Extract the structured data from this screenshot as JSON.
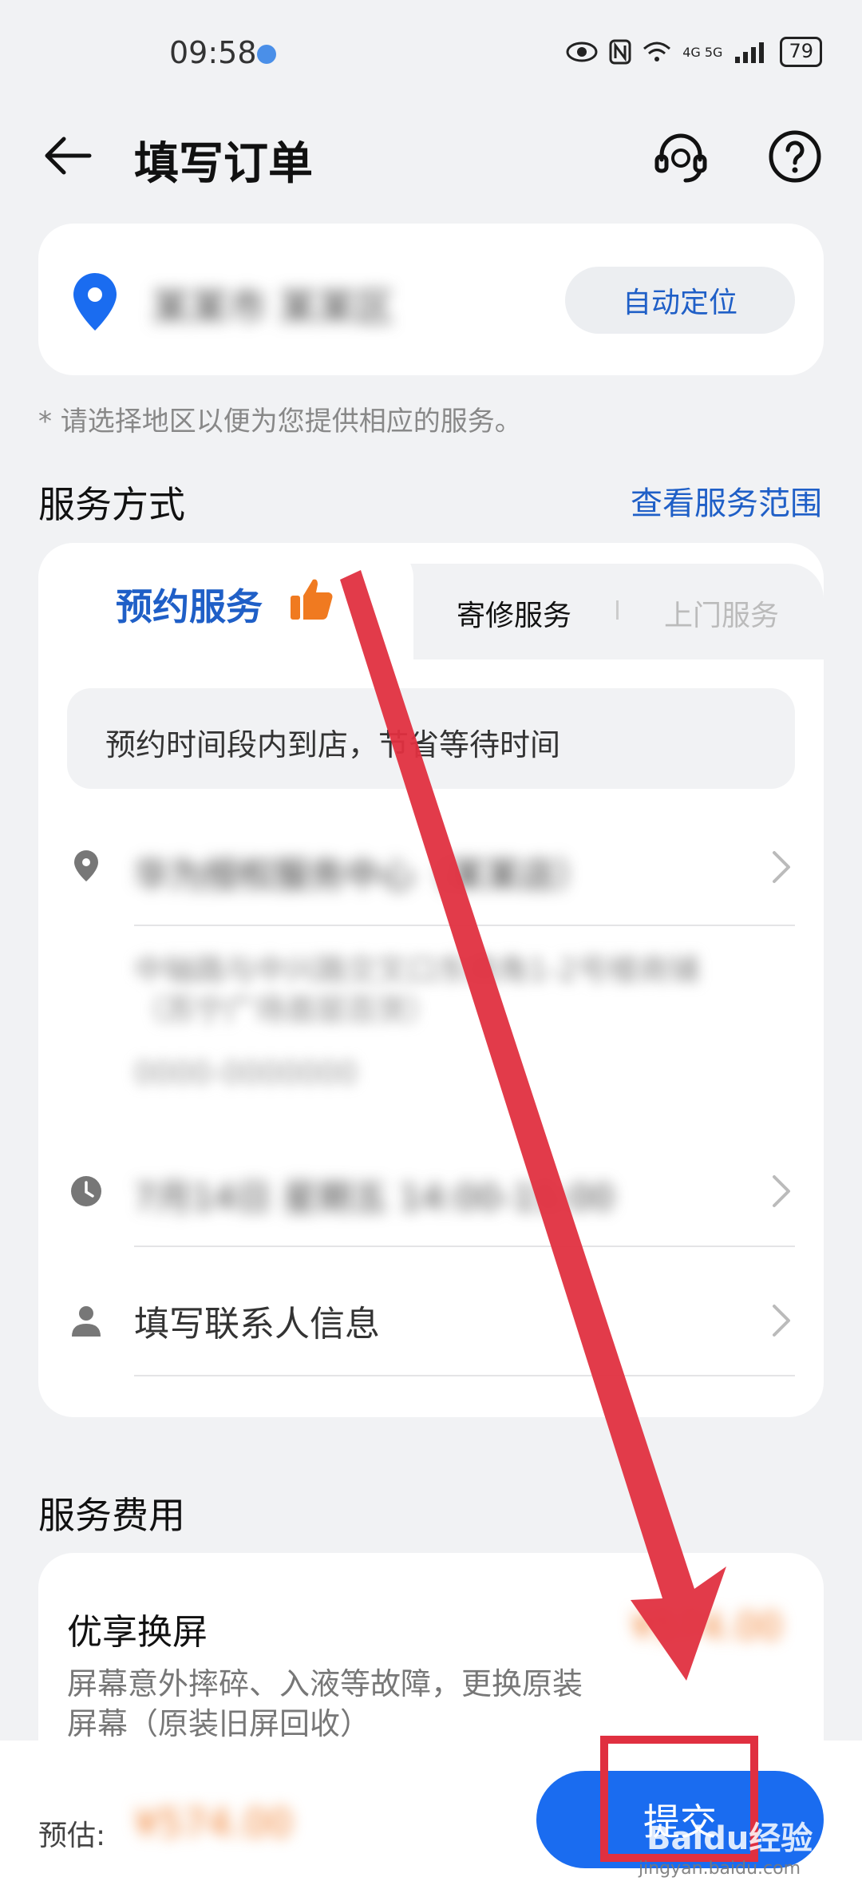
{
  "status_bar": {
    "time": "09:58",
    "network_labels": "4G 5G",
    "battery": "79"
  },
  "header": {
    "title": "填写订单",
    "back_icon": "arrow-left-icon",
    "cs_icon": "headset-icon",
    "help_icon": "question-circle-icon"
  },
  "location": {
    "region_text": "某某市 某某区",
    "auto_locate_label": "自动定位",
    "note": "* 请选择地区以便为您提供相应的服务。"
  },
  "service_section": {
    "title": "服务方式",
    "link": "查看服务范围",
    "tabs": [
      {
        "label": "预约服务",
        "active": true
      },
      {
        "label": "寄修服务",
        "active": false
      },
      {
        "label": "上门服务",
        "active": false
      }
    ],
    "tip": "预约时间段内到店，节省等待时间",
    "store_name": "华为授权服务中心（某某店）",
    "store_address": "中轴路与中兴路交叉口东南角1-2号楼商铺（苏宁广场首层百货）",
    "store_phone": "0000-0000000",
    "time_slot": "7月14日 星期五 14:00-15:00",
    "contact_label": "填写联系人信息"
  },
  "fee_section": {
    "title": "服务费用",
    "item_name": "优享换屏",
    "item_price": "¥574.00",
    "item_desc": "屏幕意外摔碎、入液等故障，更换原装屏幕（原装旧屏回收）"
  },
  "bottom_bar": {
    "estimate_label": "预估:",
    "estimate_price": "¥574.00",
    "submit_label": "提交"
  },
  "watermark": {
    "text": "Baidu经验",
    "sub": "jingyan.baidu.com"
  },
  "colors": {
    "accent": "#1f5fc7",
    "primary_button": "#1a6cf0",
    "price": "#f08030",
    "annotation": "#e03040"
  }
}
